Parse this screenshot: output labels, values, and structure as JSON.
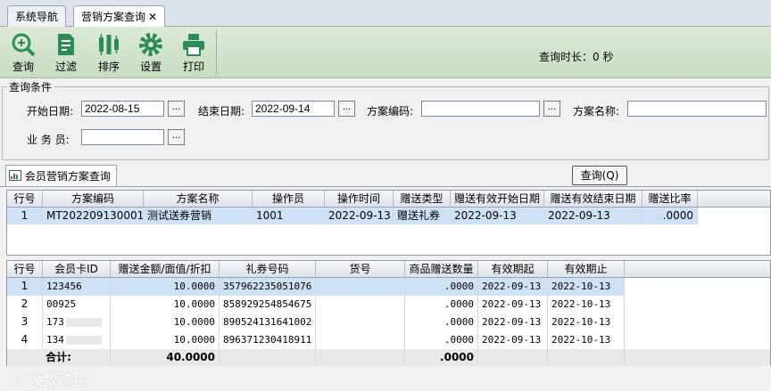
{
  "tabs": [
    {
      "label": "系统导航"
    },
    {
      "label": "营销方案查询",
      "close": "✕"
    }
  ],
  "toolbar": {
    "query": "查询",
    "filter": "过滤",
    "sort": "排序",
    "settings": "设置",
    "print": "打印",
    "duration": "查询时长：0 秒"
  },
  "conditions": {
    "title": "查询条件",
    "start_label": "开始日期:",
    "start_value": "2022-08-15",
    "end_label": "结束日期:",
    "end_value": "2022-09-14",
    "code_label": "方案编码:",
    "code_value": "",
    "name_label": "方案名称:",
    "name_value": "",
    "staff_label": "业 务 员:",
    "staff_value": "",
    "dots": "..."
  },
  "subtab": {
    "label": "会员营销方案查询"
  },
  "query_button": "查询(Q)",
  "grid1": {
    "headers": [
      "行号",
      "方案编码",
      "方案名称",
      "操作员",
      "操作时间",
      "赠送类型",
      "赠送有效开始日期",
      "赠送有效结束日期",
      "赠送比率"
    ],
    "rows": [
      [
        "1",
        "MT202209130001",
        "测试送券营销",
        "1001",
        "2022-09-13",
        "赠送礼券",
        "2022-09-13",
        "2022-09-13",
        ".0000"
      ]
    ]
  },
  "grid2": {
    "headers": [
      "行号",
      "会员卡ID",
      "赠送金额/面值/折扣",
      "礼券号码",
      "货号",
      "商品赠送数量",
      "有效期起",
      "有效期止"
    ],
    "rows": [
      [
        "1",
        "123456",
        "10.0000",
        "357962235051076",
        "",
        ".0000",
        "2022-09-13",
        "2022-10-13"
      ],
      [
        "2",
        "00925",
        "10.0000",
        "858929254854675",
        "",
        ".0000",
        "2022-09-13",
        "2022-10-13"
      ],
      [
        "3",
        "173",
        "10.0000",
        "890524131641002",
        "",
        ".0000",
        "2022-09-13",
        "2022-10-13"
      ],
      [
        "4",
        "134",
        "10.0000",
        "896371230418911",
        "",
        ".0000",
        "2022-09-13",
        "2022-10-13"
      ]
    ],
    "total_label": "合计:",
    "total_amount": "40.0000",
    "total_qty": ".0000"
  },
  "watermark": "大数跨境",
  "colors": {
    "toolbar_bg": "#d4e6ce",
    "selected_row": "#cfe1f5",
    "icon_green": "#2e8b57"
  }
}
